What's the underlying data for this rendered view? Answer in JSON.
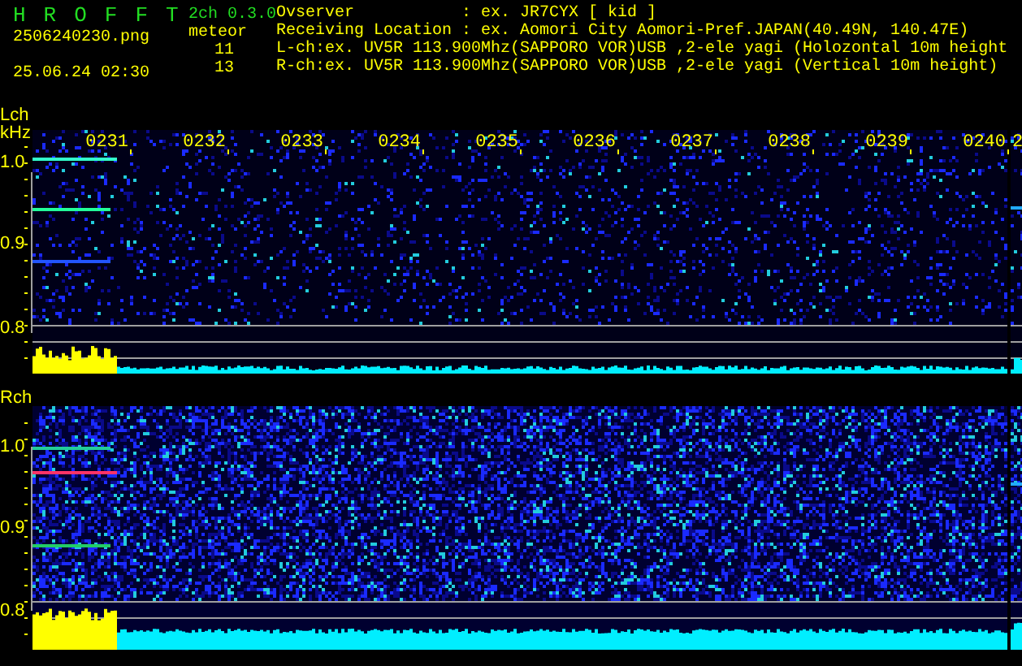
{
  "header": {
    "app_name": "H R O F F T",
    "version": "2ch 0.3.0",
    "filename": "2506240230.png",
    "datetime": "25.06.24 02:30",
    "meteor_label": "meteor",
    "meteor_counts": [
      "11",
      "13"
    ],
    "info_lines": [
      "Ovserver           : ex. JR7CYX [ kid ]",
      "Receiving Location : ex. Aomori City Aomori-Pref.JAPAN(40.49N, 140.47E)",
      "L-ch:ex. UV5R 113.900Mhz(SAPPORO VOR)USB ,2-ele yagi (Holozontal 10m height",
      "R-ch:ex. UV5R 113.900Mhz(SAPPORO VOR)USB ,2-ele yagi (Vertical 10m height)"
    ]
  },
  "channels": [
    {
      "name": "Lch",
      "unit": "kHz",
      "frequency_ticks": [
        "1.0",
        "0.9",
        "0.8"
      ],
      "time_ticks": [
        "0231",
        "0232",
        "0233",
        "0234",
        "0235",
        "0236",
        "0237",
        "0238",
        "0239",
        "0240",
        "2"
      ]
    },
    {
      "name": "Rch",
      "frequency_ticks": [
        "1.0",
        "0.9",
        "0.8"
      ]
    }
  ]
}
